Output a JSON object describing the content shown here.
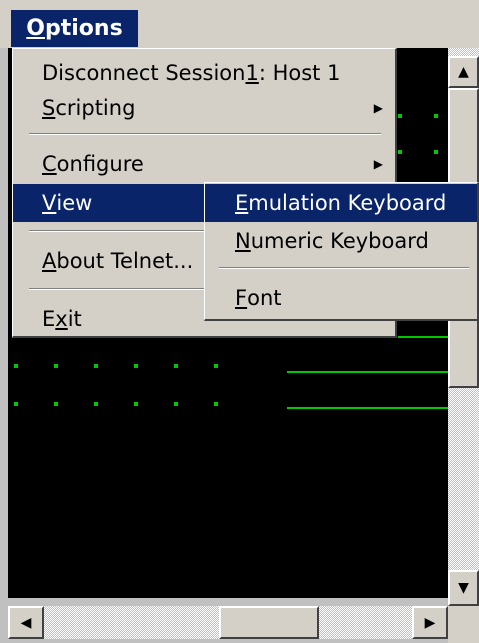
{
  "menubar": {
    "options": {
      "mnemonic": "O",
      "rest": "ptions"
    }
  },
  "options_menu": {
    "disconnect": {
      "before": "Disconnect Session ",
      "mnemonic": "1",
      "after": ": Host 1"
    },
    "scripting": {
      "mnemonic": "S",
      "rest": "cripting"
    },
    "configure": {
      "mnemonic": "C",
      "rest": "onfigure"
    },
    "view": {
      "mnemonic": "V",
      "rest": "iew"
    },
    "about": {
      "mnemonic": "A",
      "rest": "bout Telnet..."
    },
    "exit": {
      "before": "E",
      "mnemonic": "x",
      "after": "it"
    }
  },
  "view_submenu": {
    "emulation_keyboard": {
      "mnemonic": "E",
      "rest": "mulation Keyboard"
    },
    "numeric_keyboard": {
      "mnemonic": "N",
      "rest": "umeric Keyboard"
    },
    "font": {
      "mnemonic": "F",
      "rest": "ont"
    }
  },
  "icons": {
    "submenu_arrow": "▶",
    "scroll_up": "▲",
    "scroll_down": "▼",
    "scroll_left": "◀",
    "scroll_right": "▶"
  },
  "colors": {
    "menu_bg": "#d4d0c8",
    "highlight": "#0a246a",
    "terminal_bg": "#000000",
    "terminal_fg": "#00c800"
  }
}
